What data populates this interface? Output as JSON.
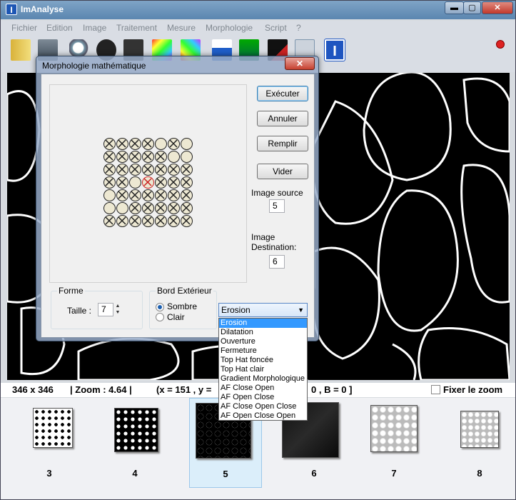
{
  "app": {
    "title": "ImAnalyse"
  },
  "window_buttons": {
    "minimize": "▬",
    "maximize": "▢",
    "close": "✕"
  },
  "menu": [
    "Fichier",
    "Edition",
    "Image",
    "Traitement",
    "Mesure",
    "Morphologie",
    "Script",
    "?"
  ],
  "toolbar": {
    "tools": [
      "folder-icon",
      "scanner-icon",
      "zoom-icon",
      "rotate-left-icon",
      "rotate-right-icon",
      "color-image-icon",
      "color-image2-icon",
      "upload-icon",
      "histogram-icon",
      "curve-icon",
      "crop-icon",
      "logo-icon"
    ]
  },
  "dialog": {
    "title": "Morphologie mathématique",
    "close": "✕",
    "buttons": {
      "executer": "Exécuter",
      "annuler": "Annuler",
      "remplir": "Remplir",
      "vider": "Vider"
    },
    "image_source_label": "Image source",
    "image_source_value": "5",
    "image_dest_label1": "Image",
    "image_dest_label2": "Destination:",
    "image_dest_value": "6",
    "forme_legend": "Forme",
    "taille_label": "Taille :",
    "taille_value": "7",
    "bord_legend": "Bord Extérieur",
    "sombre_label": "Sombre",
    "clair_label": "Clair",
    "selected_operation": "Erosion",
    "operations": [
      "Erosion",
      "Dilatation",
      "Ouverture",
      "Fermeture",
      "Top Hat foncée",
      "Top Hat clair",
      "Gradient Morphologique",
      "AF Close Open",
      "AF Open Close",
      "AF Close Open Close",
      "AF Open Close Open"
    ],
    "grid": [
      [
        1,
        1,
        1,
        1,
        0,
        1,
        0
      ],
      [
        1,
        1,
        1,
        1,
        1,
        0,
        0
      ],
      [
        1,
        1,
        1,
        1,
        1,
        1,
        1
      ],
      [
        1,
        1,
        0,
        2,
        1,
        1,
        1
      ],
      [
        0,
        1,
        1,
        1,
        1,
        1,
        1
      ],
      [
        0,
        0,
        1,
        1,
        1,
        1,
        1
      ],
      [
        1,
        1,
        1,
        1,
        1,
        1,
        1
      ]
    ]
  },
  "status": {
    "size": "346 x 346",
    "zoom": "|   Zoom : 4.64   |",
    "coords": "(x = 151 , y =",
    "rgb": "0 , B = 0 ]",
    "fixer": "Fixer le zoom"
  },
  "thumbnails": [
    {
      "label": "3",
      "style": "blobs"
    },
    {
      "label": "4",
      "style": "blobs-inverted"
    },
    {
      "label": "5",
      "style": "edges"
    },
    {
      "label": "6",
      "style": "dark"
    },
    {
      "label": "7",
      "style": "relief"
    },
    {
      "label": "8",
      "style": "relief-small"
    }
  ],
  "colors": {
    "selection": "#3399ff",
    "center_cell": "#cc2222"
  }
}
